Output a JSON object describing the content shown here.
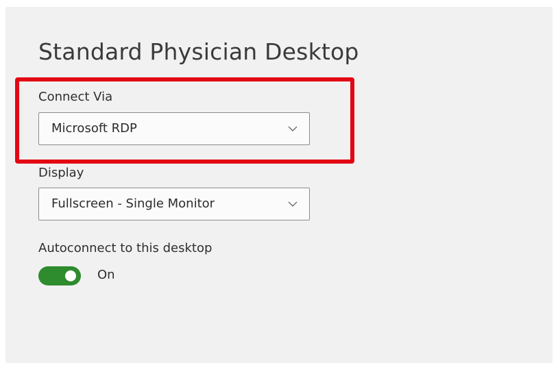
{
  "page": {
    "title": "Standard Physician Desktop"
  },
  "connect_via": {
    "label": "Connect Via",
    "selected_value": "Microsoft RDP",
    "chevron_icon": "chevron-down-icon"
  },
  "display": {
    "label": "Display",
    "selected_value": "Fullscreen - Single Monitor",
    "chevron_icon": "chevron-down-icon"
  },
  "autoconnect": {
    "label": "Autoconnect to this desktop",
    "state_text": "On",
    "enabled": true
  },
  "colors": {
    "toggle_on": "#2e8b2e",
    "highlight_box": "#e30613",
    "panel_background": "#f1f1f1"
  }
}
